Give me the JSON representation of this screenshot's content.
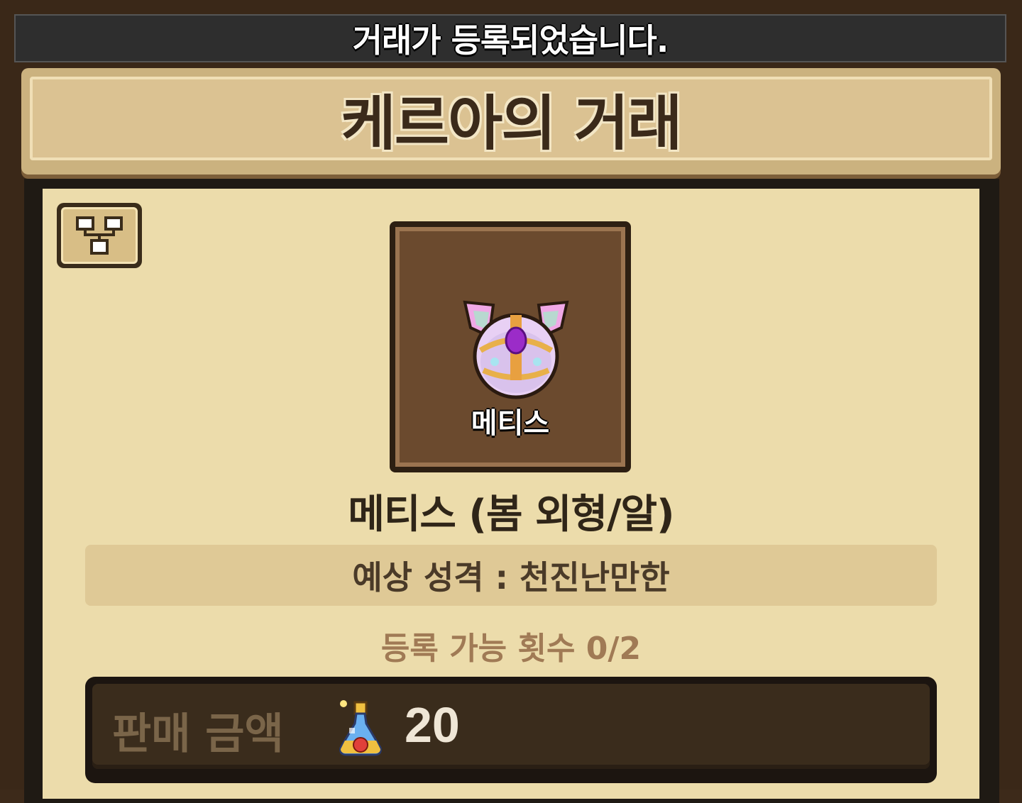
{
  "toast": {
    "message": "거래가 등록되었습니다."
  },
  "header": {
    "title": "케르아의 거래"
  },
  "tree_button": {
    "icon": "hierarchy-tree-icon"
  },
  "item": {
    "slot_label": "메티스",
    "name": "메티스 (봄 외형/알)",
    "personality": "예상 성격 : 천진난만한",
    "registration_count": "등록 가능 횟수 0/2"
  },
  "price": {
    "label": "판매 금액",
    "currency_icon": "potion-bottle-icon",
    "value": "20"
  },
  "colors": {
    "panel": "#ecdcab",
    "banner": "#dbc292",
    "dark_frame": "#3a2818",
    "item_bg": "#6b4a2e"
  }
}
